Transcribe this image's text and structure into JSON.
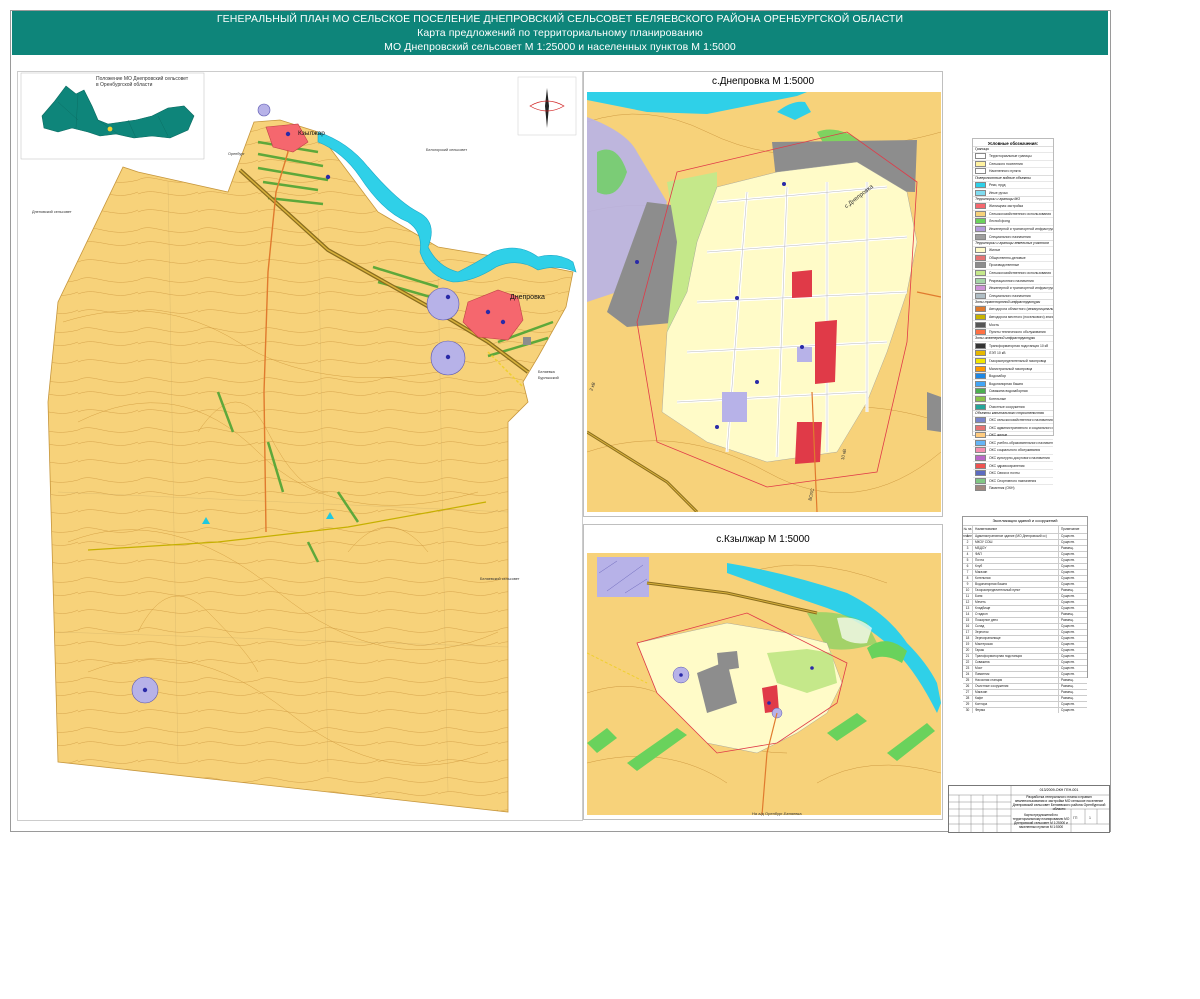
{
  "header": {
    "line1": "ГЕНЕРАЛЬНЫЙ ПЛАН МО СЕЛЬСКОЕ ПОСЕЛЕНИЕ ДНЕПРОВСКИЙ СЕЛЬСОВЕТ  БЕЛЯЕВСКОГО РАЙОНА ОРЕНБУРГСКОЙ ОБЛАСТИ",
    "line2": "Карта предложений по территориальному планированию",
    "line3": "МО Днепровский сельсовет М 1:25000  и населенных пунктов М 1:5000"
  },
  "main_map": {
    "inset_title_1": "Положение МО Днепровский сельсовет",
    "inset_title_2": "в Оренбургской области",
    "settlement_1": "Кзылжар",
    "settlement_2": "Днепровка",
    "neighbor_west": "Дненовский сельсовет",
    "neighbor_north": "Белогорский сельсовет",
    "neighbor_east": "Беляевский сельсовет",
    "road_west": "Оренбург",
    "road_east_1": "Беляевка",
    "road_east_2": "Бурлыкский"
  },
  "inset_dneprovka": {
    "title": "с.Днепровка М 1:5000",
    "label": "с.Днепровка",
    "line_label_1": "ВОЛС",
    "line_label_2": "10 кВ",
    "line_label_3": "2 кВ"
  },
  "inset_kzylzhar": {
    "title": "с.Кзылжар М 1:5000",
    "road_label": "На а/д Оренбург-Беляевка"
  },
  "legend": {
    "title": "Условные обозначения:",
    "rows": [
      {
        "type": "h",
        "text": "Границы"
      },
      {
        "type": "r",
        "text": "Территориальные границы",
        "color": "#ffffff"
      },
      {
        "type": "r",
        "text": "Сельского поселения",
        "color": "#fff2a0"
      },
      {
        "type": "r",
        "text": "Населенного пункта",
        "color": "#ffffff"
      },
      {
        "type": "h",
        "text": "Поверхностные водные объекты"
      },
      {
        "type": "r",
        "text": "Реки, пруд",
        "color": "#2fd0e8"
      },
      {
        "type": "r",
        "text": "Иные ручьи",
        "color": "#7fdcf0"
      },
      {
        "type": "h",
        "text": "Территории и границы МО"
      },
      {
        "type": "r",
        "text": "Жилищная застройка",
        "color": "#f5676e"
      },
      {
        "type": "r",
        "text": "Сельскохозяйственного использования",
        "color": "#f7d27a"
      },
      {
        "type": "r",
        "text": "Лесной фонд",
        "color": "#6ad25c"
      },
      {
        "type": "r",
        "text": "Инженерной и транспортной инфраструктуры",
        "color": "#b39ddb"
      },
      {
        "type": "r",
        "text": "Специального назначения",
        "color": "#9e9e9e"
      },
      {
        "type": "h",
        "text": "Территории и границы земельных участков"
      },
      {
        "type": "r",
        "text": "Жилые",
        "color": "#fffbc8"
      },
      {
        "type": "r",
        "text": "Общественно-деловые",
        "color": "#e57373"
      },
      {
        "type": "r",
        "text": "Производственные",
        "color": "#8d8d8d"
      },
      {
        "type": "r",
        "text": "Сельскохозяйственного использования",
        "color": "#c5e88a"
      },
      {
        "type": "r",
        "text": "Рекреационного назначения",
        "color": "#a5d6a7"
      },
      {
        "type": "r",
        "text": "Инженерной и транспортной инфраструктуры",
        "color": "#ce93d8"
      },
      {
        "type": "r",
        "text": "Специального назначения",
        "color": "#b0bec5"
      },
      {
        "type": "h",
        "text": "Зоны транспортной инфраструктуры"
      },
      {
        "type": "r",
        "text": "Автодорога областного (межмуниципального) значения",
        "color": "#e07a2e"
      },
      {
        "type": "r",
        "text": "Автодорога местного (поселкового) значения",
        "color": "#c8b400"
      },
      {
        "type": "r",
        "text": "Мосты",
        "color": "#555555"
      },
      {
        "type": "r",
        "text": "Пункты технического обслуживания",
        "color": "#ff7043"
      },
      {
        "type": "h",
        "text": "Зоны инженерной инфраструктуры"
      },
      {
        "type": "r",
        "text": "Трансформаторная подстанция 10 кВ",
        "color": "#333333"
      },
      {
        "type": "r",
        "text": "ЛЭП 10 кВ",
        "color": "#e6b800"
      },
      {
        "type": "r",
        "text": "Газораспределительный газопровод",
        "color": "#f2e600"
      },
      {
        "type": "r",
        "text": "Магистральный газопровод",
        "color": "#ff9800"
      },
      {
        "type": "r",
        "text": "Водозабор",
        "color": "#1e88e5"
      },
      {
        "type": "r",
        "text": "Водонапорная башня",
        "color": "#42a5f5"
      },
      {
        "type": "r",
        "text": "Скважина водозаборная",
        "color": "#4caf50"
      },
      {
        "type": "r",
        "text": "Котельные",
        "color": "#8bc34a"
      },
      {
        "type": "r",
        "text": "Очистные сооружения",
        "color": "#26a69a"
      },
      {
        "type": "h",
        "text": "Объекты капитального строительства"
      },
      {
        "type": "r",
        "text": "ОКС сельскохозяйственного назначения",
        "color": "#7986cb"
      },
      {
        "type": "r",
        "text": "ОКС административного и социального назначения",
        "color": "#e57373"
      },
      {
        "type": "r",
        "text": "ОКС жилые",
        "color": "#ffcc80"
      },
      {
        "type": "r",
        "text": "ОКС учебно-образовательного назначения",
        "color": "#64b5f6"
      },
      {
        "type": "r",
        "text": "ОКС социального обслуживания",
        "color": "#f48fb1"
      },
      {
        "type": "r",
        "text": "ОКС культурно-досугового назначения",
        "color": "#ba68c8"
      },
      {
        "type": "r",
        "text": "ОКС здравоохранения",
        "color": "#ef5350"
      },
      {
        "type": "r",
        "text": "ОКС Связи и почты",
        "color": "#5c6bc0"
      },
      {
        "type": "r",
        "text": "ОКС Спортивного назначения",
        "color": "#81c784"
      },
      {
        "type": "r",
        "text": "Памятник (ОКН)",
        "color": "#a1887f"
      }
    ]
  },
  "buildings_table": {
    "title": "Экспликация зданий и сооружений",
    "col_1": "№ на плане",
    "col_2": "Наименование",
    "col_3": "Примечание",
    "rows": [
      [
        "1",
        "Административное здание (МО Днепровский сс)",
        "Существ."
      ],
      [
        "2",
        "МКОУ СОШ",
        "Существ."
      ],
      [
        "3",
        "МБДОУ",
        "Размещ."
      ],
      [
        "4",
        "ФАП",
        "Существ."
      ],
      [
        "5",
        "Почта",
        "Существ."
      ],
      [
        "6",
        "Клуб",
        "Существ."
      ],
      [
        "7",
        "Магазин",
        "Существ."
      ],
      [
        "8",
        "Котельная",
        "Существ."
      ],
      [
        "9",
        "Водонапорная башня",
        "Существ."
      ],
      [
        "10",
        "Газораспределительный пункт",
        "Размещ."
      ],
      [
        "11",
        "Баня",
        "Существ."
      ],
      [
        "12",
        "Мечеть",
        "Существ."
      ],
      [
        "13",
        "Кладбище",
        "Существ."
      ],
      [
        "14",
        "Стадион",
        "Размещ."
      ],
      [
        "15",
        "Пожарное депо",
        "Размещ."
      ],
      [
        "16",
        "Склад",
        "Существ."
      ],
      [
        "17",
        "Зерноток",
        "Существ."
      ],
      [
        "18",
        "Зернохранилище",
        "Существ."
      ],
      [
        "19",
        "Мастерская",
        "Существ."
      ],
      [
        "20",
        "Гараж",
        "Существ."
      ],
      [
        "21",
        "Трансформаторная подстанция",
        "Существ."
      ],
      [
        "22",
        "Скважина",
        "Существ."
      ],
      [
        "23",
        "Мост",
        "Существ."
      ],
      [
        "24",
        "Памятник",
        "Существ."
      ],
      [
        "25",
        "Насосная станция",
        "Размещ."
      ],
      [
        "26",
        "Очистные сооружения",
        "Размещ."
      ],
      [
        "27",
        "Магазин",
        "Размещ."
      ],
      [
        "28",
        "Кафе",
        "Размещ."
      ],
      [
        "29",
        "Контора",
        "Существ."
      ],
      [
        "30",
        "Ферма",
        "Существ."
      ]
    ]
  },
  "stamp": {
    "code": "013/2009-ОКН ГЕН-001",
    "project": "Разработка генерального плана и правил землепользования и застройки МО сельское поселение Днепровский сельсовет Беляевского района Оренбургской области",
    "sheet_name": "Карта предложений по территориальному планированию МО Днепровский сельсовет М 1:25000 и населенных пунктов М 1:5000",
    "stage": "ГП",
    "sheet": "1"
  }
}
